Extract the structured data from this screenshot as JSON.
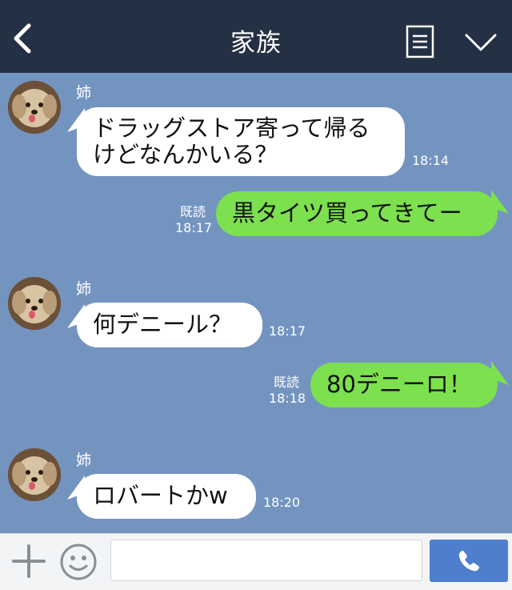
{
  "header": {
    "title": "家族"
  },
  "messages": [
    {
      "sender": "姉",
      "line1": "ドラッグストア寄って帰る",
      "line2": "けどなんかいる？",
      "time": "18:14"
    },
    {
      "text": "黒タイツ買ってきてー",
      "read": "既読",
      "time": "18:17"
    },
    {
      "sender": "姉",
      "text": "何デニール？",
      "time": "18:17"
    },
    {
      "text": "80デニーロ！",
      "read": "既読",
      "time": "18:18"
    },
    {
      "sender": "姉",
      "text": "ロバートかw",
      "time": "18:20"
    }
  ],
  "input": {
    "placeholder": "",
    "value": ""
  },
  "colors": {
    "header": "#243043",
    "background": "#7494c0",
    "outgoing": "#7ce04f",
    "incoming": "#ffffff",
    "call": "#4f7ecd"
  },
  "icons": [
    "back-icon",
    "menu-icon",
    "chevron-down-icon",
    "plus-icon",
    "emoji-icon",
    "phone-icon",
    "dog-avatar"
  ]
}
